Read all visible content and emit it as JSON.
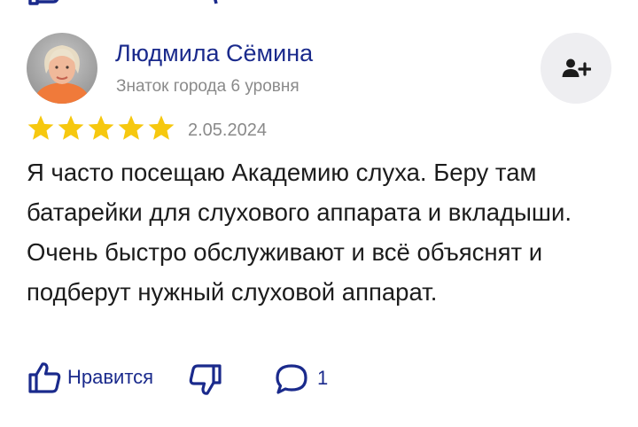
{
  "review": {
    "author_name": "Людмила Сёмина",
    "author_level": "Знаток города 6 уровня",
    "rating": 5,
    "date": "2.05.2024",
    "text": "Я часто посещаю Академию слуха. Беру там батарейки для слухового аппарата и вкладыши. Очень быстро обслуживают и всё объяснят и подберут нужный слуховой аппарат."
  },
  "actions": {
    "like_label": "Нравится",
    "comment_count": "1"
  },
  "colors": {
    "accent": "#1a2a8c",
    "star": "#f6c80f",
    "muted": "#8a8a8a",
    "button_bg": "#eeeef1"
  },
  "icons": {
    "subscribe": "add-user-icon",
    "like": "thumbs-up-icon",
    "dislike": "thumbs-down-icon",
    "comment": "comment-icon",
    "star": "star-icon"
  }
}
